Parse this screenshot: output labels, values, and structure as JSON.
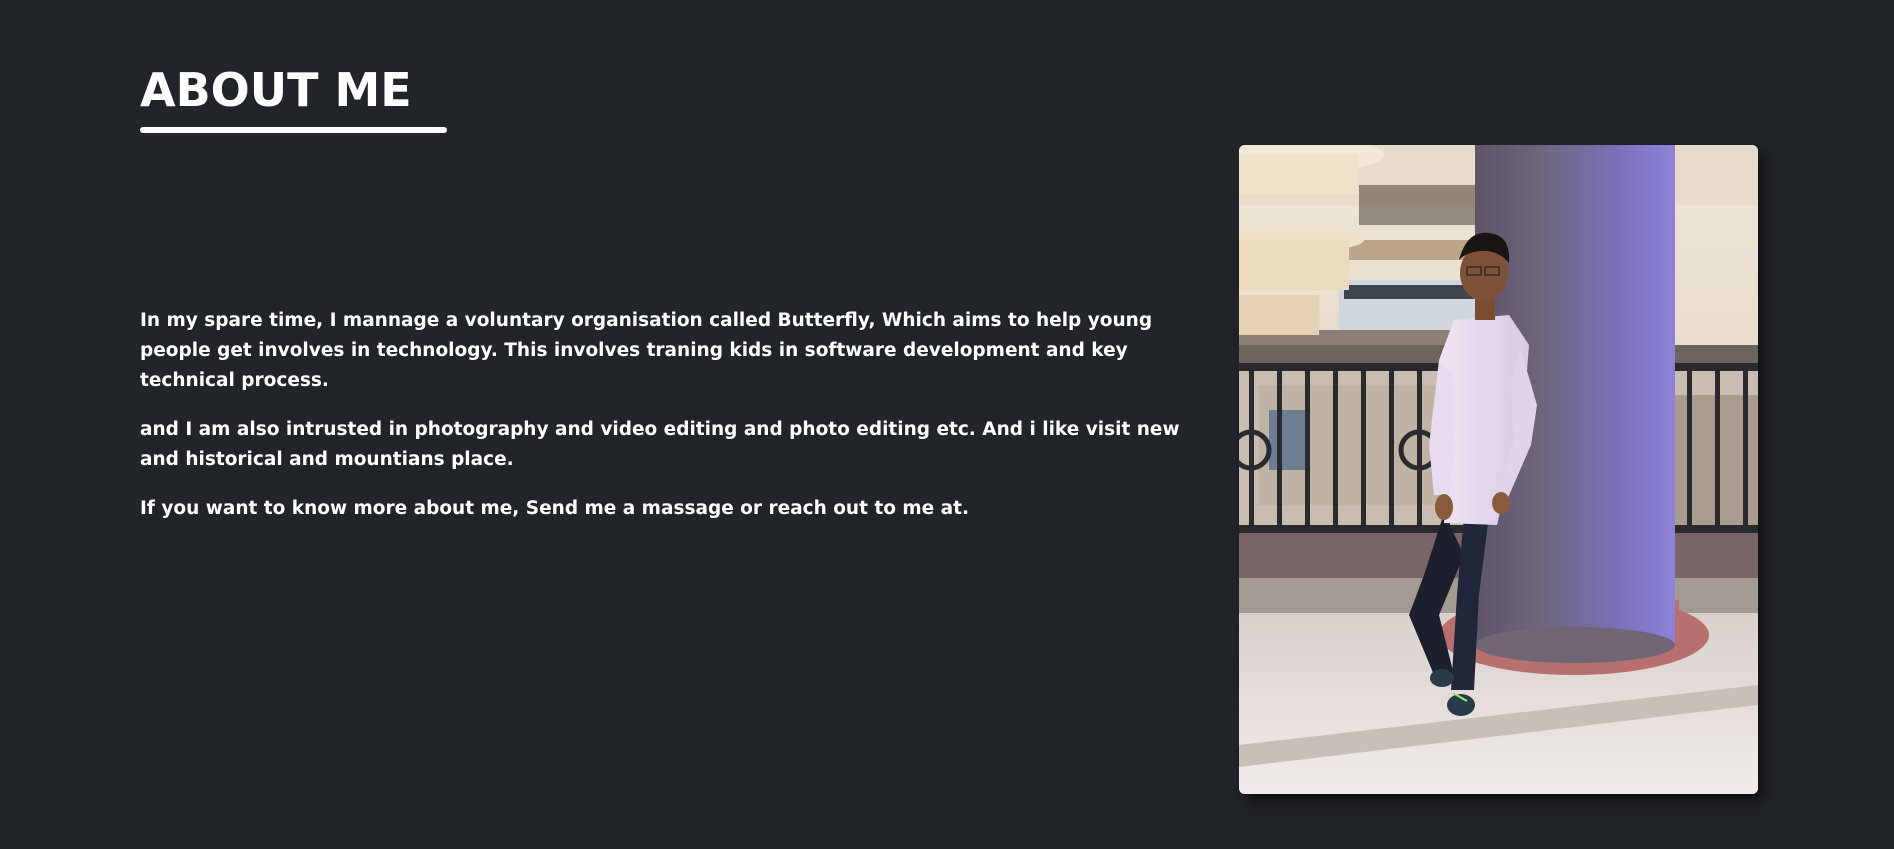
{
  "about": {
    "title": "ABOUT ME",
    "paragraphs": [
      "In my spare time, I mannage a voluntary organisation called Butterfly, Which aims to help young people get involves in technology. This involves traning kids in software development and key technical process.",
      "and I am also intrusted in photography and video editing and photo editing etc. And i like visit new and historical and mountians place.",
      "If you want to know more about me, Send me a massage or reach out to me at."
    ]
  },
  "colors": {
    "background": "#212428",
    "text": "#ffffff",
    "accent": "#ffffff"
  }
}
